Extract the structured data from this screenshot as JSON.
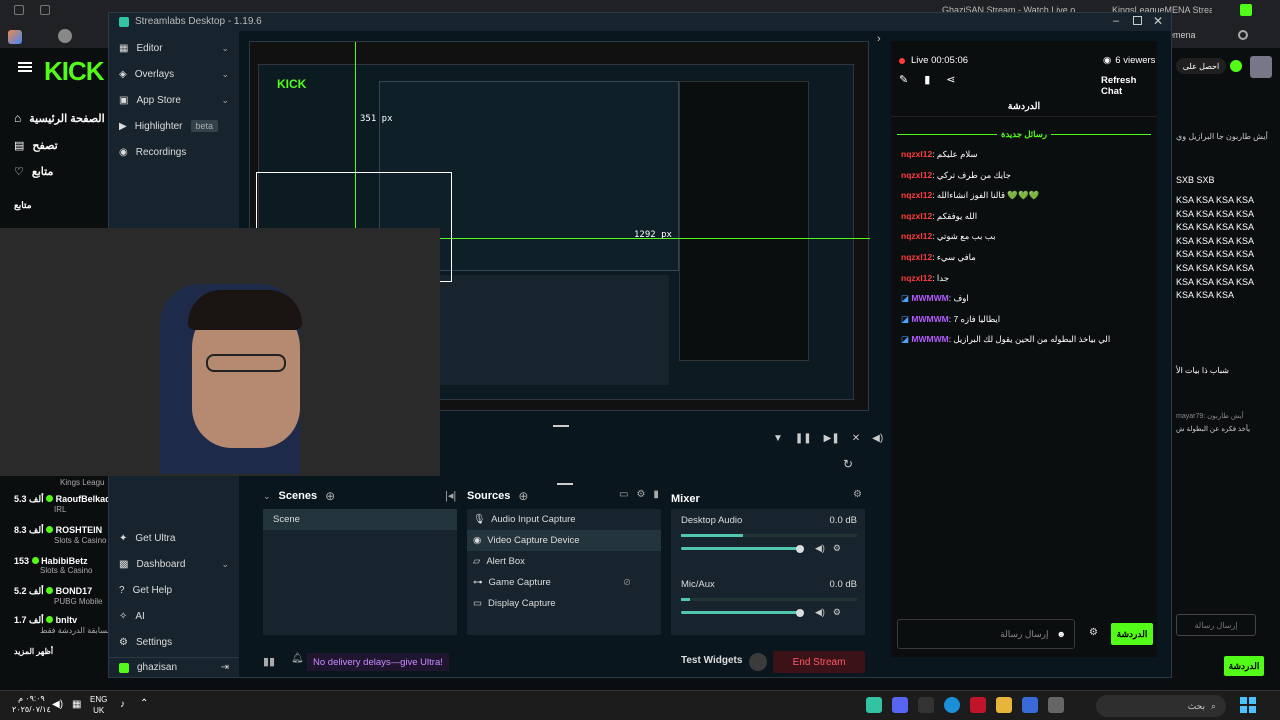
{
  "browser": {
    "tab_left": "GhaziSAN Stream - Watch Live o...",
    "tab_right": "KingsLeagueMENA Stream",
    "profile_label": "emena"
  },
  "kick_left": {
    "logo": "KICK",
    "nav": [
      "الصفحة الرئيسية",
      "تصفح",
      "متابع"
    ],
    "following_header": "متابع",
    "partial_header": "Kings Leagu",
    "streamers": [
      {
        "name": "RaoufBelkac",
        "viewers": "5.3",
        "unit": "ألف",
        "sub": "IRL"
      },
      {
        "name": "ROSHTEIN",
        "viewers": "8.3",
        "unit": "ألف",
        "sub": "Slots & Casino"
      },
      {
        "name": "HabibiBetz",
        "viewers": "153",
        "unit": "",
        "sub": "Slots & Casino"
      },
      {
        "name": "BOND17",
        "viewers": "5.2",
        "unit": "ألف",
        "sub": "PUBG Mobile"
      },
      {
        "name": "bnltv",
        "viewers": "1.7",
        "unit": "ألف",
        "sub": "المسابقة الدردشة فقط"
      }
    ],
    "show_more": "أظهر المزيد"
  },
  "kick_right": {
    "top_btn": "احصل على",
    "lines": [
      "أيش طاربون جا البرازيل وي",
      "SXB SXB",
      "شباب ذا بيات الأ",
      "mayar79: أيش طاربون",
      "يأخذ فكره عن البطولة ش"
    ],
    "ksa_rows": [
      "KSA KSA KSA KSA",
      "KSA KSA KSA KSA",
      "KSA KSA KSA KSA",
      "KSA KSA KSA KSA",
      "KSA KSA KSA KSA",
      "KSA KSA KSA KSA",
      "KSA KSA KSA KSA",
      "KSA KSA KSA"
    ],
    "input_placeholder": "إرسال رسالة",
    "send": "الدردشة"
  },
  "streamlabs": {
    "title": "Streamlabs Desktop - 1.19.6",
    "sidebar_top": [
      {
        "label": "Editor",
        "chevron": true
      },
      {
        "label": "Overlays",
        "chevron": true
      },
      {
        "label": "App Store",
        "chevron": true
      },
      {
        "label": "Highlighter",
        "badge": "beta"
      },
      {
        "label": "Recordings"
      }
    ],
    "sidebar_bottom": [
      {
        "label": "Get Ultra"
      },
      {
        "label": "Dashboard",
        "chevron": true
      },
      {
        "label": "Get Help"
      },
      {
        "label": "AI"
      },
      {
        "label": "Settings"
      }
    ],
    "user": "ghazisan",
    "preview_measure_1": "351 px",
    "preview_measure_2": "1292 px",
    "scenes_title": "Scenes",
    "scenes": [
      "Scene"
    ],
    "sources_title": "Sources",
    "sources": [
      {
        "label": "Audio Input Capture",
        "icon": "microphone-icon"
      },
      {
        "label": "Video Capture Device",
        "icon": "camera-icon",
        "selected": true
      },
      {
        "label": "Alert Box",
        "icon": "bell-icon"
      },
      {
        "label": "Game Capture",
        "icon": "gamepad-icon"
      },
      {
        "label": "Display Capture",
        "icon": "monitor-icon"
      }
    ],
    "mixer_title": "Mixer",
    "mixer": [
      {
        "label": "Desktop Audio",
        "db": "0.0 dB",
        "level": 0.35,
        "volume": 0.98
      },
      {
        "label": "Mic/Aux",
        "db": "0.0 dB",
        "level": 0.05,
        "volume": 0.98
      }
    ],
    "footer_note": "No delivery delays—give Ultra!",
    "test_widgets": "Test Widgets",
    "end_stream": "End Stream"
  },
  "chat": {
    "live_label": "Live 00:05:06",
    "viewers": "6 viewers",
    "refresh": "Refresh Chat",
    "header": "الدردشة",
    "new_messages": "رسائل جديدة",
    "messages": [
      {
        "user": "nqzxl12",
        "text": "سلام عليكم",
        "color": "red"
      },
      {
        "user": "nqzxl12",
        "text": "جايك من طرف تركي",
        "color": "red"
      },
      {
        "user": "nqzxl12",
        "text": "قالنا الفوز انشاءالله 💚💚💚",
        "color": "red"
      },
      {
        "user": "nqzxl12",
        "text": "الله يوفقكم",
        "color": "red"
      },
      {
        "user": "nqzxl12",
        "text": "بب بب مع شوتي",
        "color": "red"
      },
      {
        "user": "nqzxl12",
        "text": "مافي سيء",
        "color": "red"
      },
      {
        "user": "nqzxl12",
        "text": "جدا",
        "color": "red"
      },
      {
        "user": "MWMWM",
        "text": "اوف",
        "color": "purple"
      },
      {
        "user": "MWMWM",
        "text": "ايطاليا فازه 7",
        "color": "purple"
      },
      {
        "user": "MWMWM",
        "text": "الي بياخذ البطوله من الحين يقول لك البرازيل",
        "color": "purple"
      }
    ],
    "input_placeholder": "إرسال رسالة",
    "send": "الدردشة"
  },
  "taskbar": {
    "time": "٠٩:٠٩ م",
    "date": "٢٠٢٥/٠٧/١٤",
    "lang": "ENG",
    "region": "UK",
    "search": "بحث"
  }
}
